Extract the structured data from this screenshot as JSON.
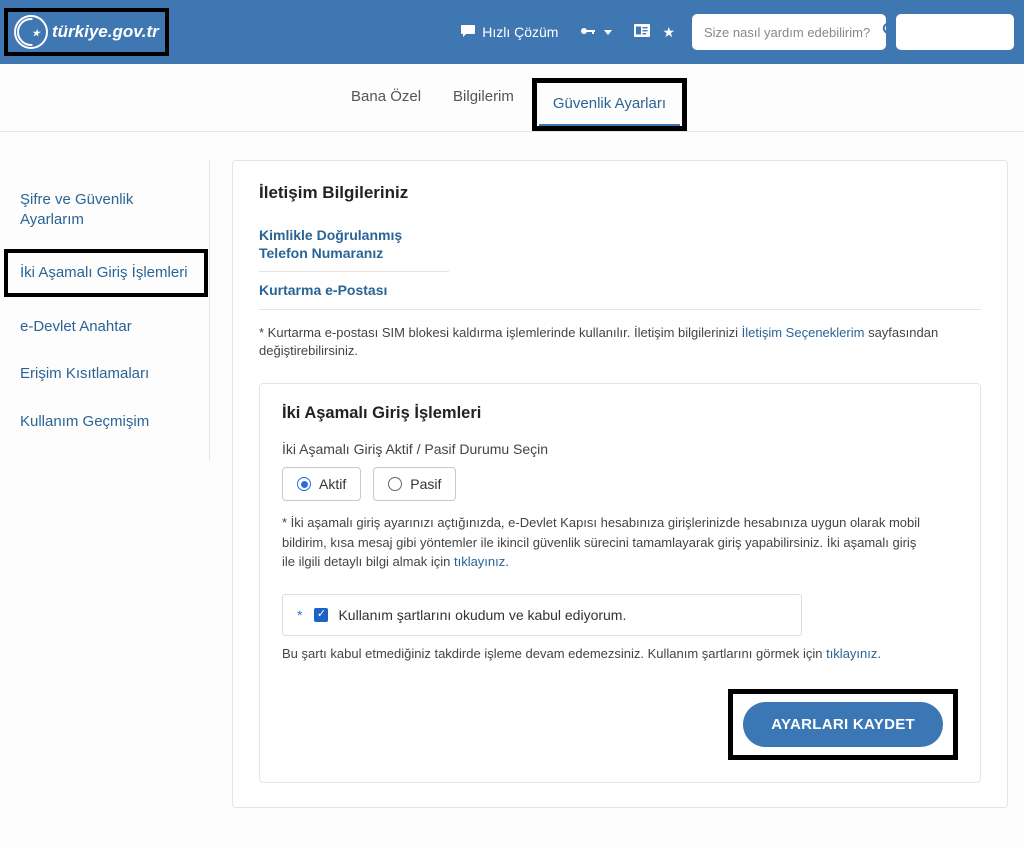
{
  "header": {
    "site": "türkiye.gov.tr",
    "quick_solution": "Hızlı Çözüm",
    "search_placeholder": "Size nasıl yardım edebilirim?"
  },
  "tabs": {
    "personal": "Bana Özel",
    "info": "Bilgilerim",
    "security": "Güvenlik Ayarları"
  },
  "sidebar": {
    "pw_security": "Şifre ve Güvenlik Ayarlarım",
    "two_factor": "İki Aşamalı Giriş İşlemleri",
    "edevlet_key": "e-Devlet Anahtar",
    "access_restrictions": "Erişim Kısıtlamaları",
    "usage_history": "Kullanım Geçmişim"
  },
  "contact": {
    "heading": "İletişim Bilgileriniz",
    "verified_phone": "Kimlikle Doğrulanmış Telefon Numaranız",
    "recovery_email": "Kurtarma e-Postası",
    "note_pre": "* Kurtarma e-postası SIM blokesi kaldırma işlemlerinde kullanılır. İletişim bilgilerinizi ",
    "note_link": "İletişim Seçeneklerim",
    "note_post": " sayfasından değiştirebilirsiniz."
  },
  "two_factor": {
    "heading": "İki Aşamalı Giriş İşlemleri",
    "select_label": "İki Aşamalı Giriş Aktif / Pasif Durumu Seçin",
    "active_label": "Aktif",
    "passive_label": "Pasif",
    "help_pre": "* İki aşamalı giriş ayarınızı açtığınızda, e-Devlet Kapısı hesabınıza girişlerinizde hesabınıza uygun olarak mobil bildirim, kısa mesaj gibi yöntemler ile ikincil güvenlik sürecini tamamlayarak giriş yapabilirsiniz. İki aşamalı giriş ile ilgili detaylı bilgi almak için ",
    "help_link": "tıklayınız",
    "terms_text": "Kullanım şartlarını okudum ve kabul ediyorum.",
    "terms_help_pre": "Bu şartı kabul etmediğiniz takdirde işleme devam edemezsiniz. Kullanım şartlarını görmek için ",
    "terms_help_link": "tıklayınız",
    "save_button": "AYARLARI KAYDET"
  }
}
